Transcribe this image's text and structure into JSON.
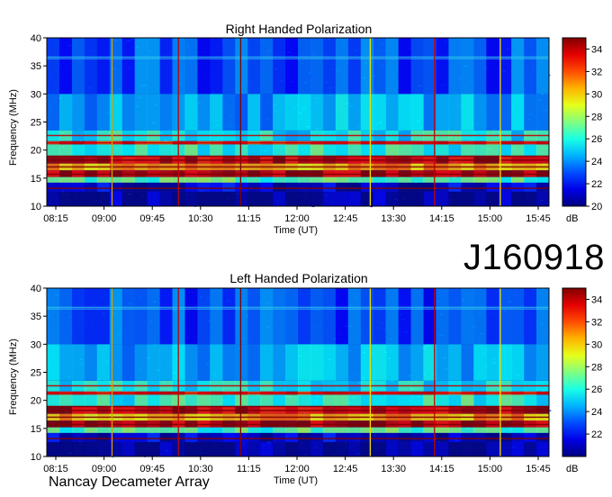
{
  "observation_id": "J160918",
  "footer_label": "Nancay Decameter Array",
  "colorbar_unit": "dB",
  "colors": {
    "background_noise": "#1430a8",
    "low": "#00008c",
    "cyan": "#33c8ee",
    "yellow": "#f0e000",
    "red": "#c00000",
    "dark_red": "#800000"
  },
  "chart_data": [
    {
      "type": "heatmap",
      "title": "Right Handed Polarization",
      "xlabel": "Time (UT)",
      "ylabel": "Frequency (MHz)",
      "x_ticks": [
        "08:15",
        "09:00",
        "09:45",
        "10:30",
        "11:15",
        "12:00",
        "12:45",
        "13:30",
        "14:15",
        "15:00",
        "15:45"
      ],
      "y_ticks": [
        10,
        15,
        20,
        25,
        30,
        35,
        40
      ],
      "ylim": [
        10,
        40
      ],
      "colorbar": {
        "ticks": [
          20,
          22,
          24,
          26,
          28,
          30,
          32,
          34
        ],
        "range": [
          20,
          35
        ],
        "unit": "dB"
      }
    },
    {
      "type": "heatmap",
      "title": "Left Handed Polarization",
      "xlabel": "Time (UT)",
      "ylabel": "Frequency (MHz)",
      "x_ticks": [
        "08:15",
        "09:00",
        "09:45",
        "10:30",
        "11:15",
        "12:00",
        "12:45",
        "13:30",
        "14:15",
        "15:00",
        "15:45"
      ],
      "y_ticks": [
        10,
        15,
        20,
        25,
        30,
        35,
        40
      ],
      "ylim": [
        10,
        40
      ],
      "colorbar": {
        "ticks": [
          22,
          24,
          26,
          28,
          30,
          32,
          34
        ],
        "range": [
          20,
          35
        ],
        "unit": "dB"
      }
    }
  ]
}
